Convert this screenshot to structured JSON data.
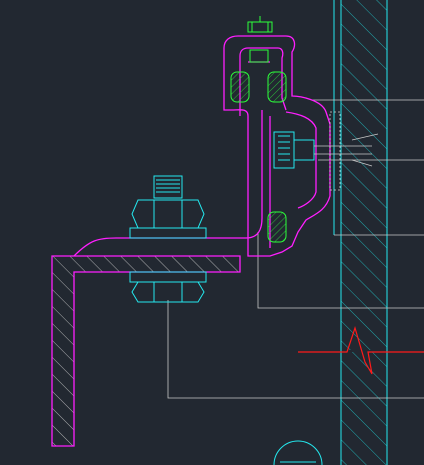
{
  "drawing": {
    "background": "#222831",
    "colors": {
      "bracket": "#ff1fff",
      "fastener": "#24e8ee",
      "gasket": "#2cff3a",
      "leader": "#c8c8c8",
      "breakline": "#ff1a1a"
    },
    "components": [
      "wall-slab",
      "angle-bracket",
      "omega-channel-bracket",
      "bolt-nut-assembly-upper",
      "bolt-nut-assembly-lower",
      "rubber-gaskets",
      "anchor-bolt",
      "top-clip-bolt",
      "break-line",
      "leader-lines",
      "section-symbol"
    ]
  }
}
